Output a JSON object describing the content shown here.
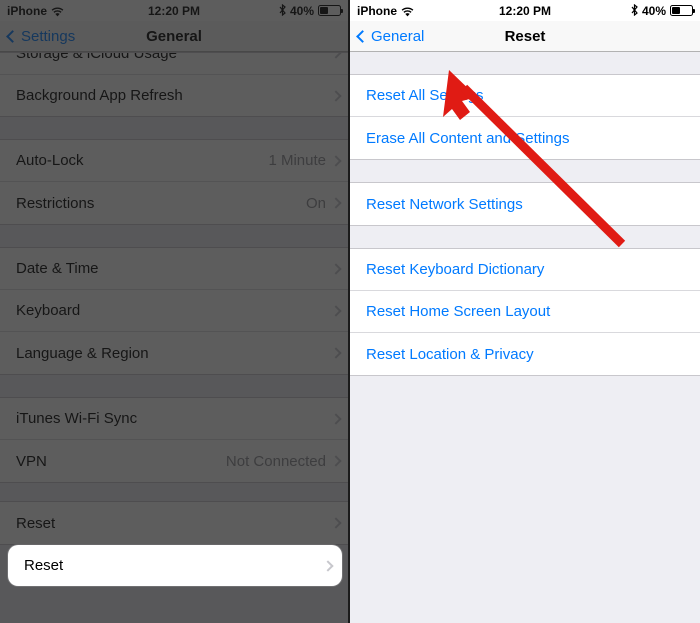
{
  "accent_blue": "#007aff",
  "arrow_color": "#e01b14",
  "left_screen": {
    "status_bar": {
      "carrier": "iPhone",
      "wifi_icon": "wifi-icon",
      "time": "12:20 PM",
      "bluetooth_icon": "bluetooth-icon",
      "battery_percent": "40%",
      "battery_icon": "battery-icon"
    },
    "nav": {
      "back_label": "Settings",
      "back_icon": "chevron-left-icon",
      "title": "General"
    },
    "sections": [
      {
        "rows": [
          {
            "label": "Storage & iCloud Usage",
            "value": "",
            "accessory": "chevron-right-icon",
            "clipped": true
          },
          {
            "label": "Background App Refresh",
            "value": "",
            "accessory": "chevron-right-icon"
          }
        ]
      },
      {
        "rows": [
          {
            "label": "Auto-Lock",
            "value": "1 Minute",
            "accessory": "chevron-right-icon"
          },
          {
            "label": "Restrictions",
            "value": "On",
            "accessory": "chevron-right-icon"
          }
        ]
      },
      {
        "rows": [
          {
            "label": "Date & Time",
            "value": "",
            "accessory": "chevron-right-icon"
          },
          {
            "label": "Keyboard",
            "value": "",
            "accessory": "chevron-right-icon"
          },
          {
            "label": "Language & Region",
            "value": "",
            "accessory": "chevron-right-icon"
          }
        ]
      },
      {
        "rows": [
          {
            "label": "iTunes Wi-Fi Sync",
            "value": "",
            "accessory": "chevron-right-icon"
          },
          {
            "label": "VPN",
            "value": "Not Connected",
            "accessory": "chevron-right-icon"
          }
        ]
      }
    ],
    "highlighted_row": {
      "label": "Reset",
      "accessory": "chevron-right-icon"
    }
  },
  "right_screen": {
    "status_bar": {
      "carrier": "iPhone",
      "wifi_icon": "wifi-icon",
      "time": "12:20 PM",
      "bluetooth_icon": "bluetooth-icon",
      "battery_percent": "40%",
      "battery_icon": "battery-icon"
    },
    "nav": {
      "back_label": "General",
      "back_icon": "chevron-left-icon",
      "title": "Reset"
    },
    "sections": [
      {
        "rows": [
          {
            "label": "Reset All Settings"
          },
          {
            "label": "Erase All Content and Settings"
          }
        ]
      },
      {
        "rows": [
          {
            "label": "Reset Network Settings"
          }
        ]
      },
      {
        "rows": [
          {
            "label": "Reset Keyboard Dictionary"
          },
          {
            "label": "Reset Home Screen Layout"
          },
          {
            "label": "Reset Location & Privacy"
          }
        ]
      }
    ],
    "annotation": {
      "type": "arrow",
      "points_to": "Reset All Settings"
    }
  }
}
